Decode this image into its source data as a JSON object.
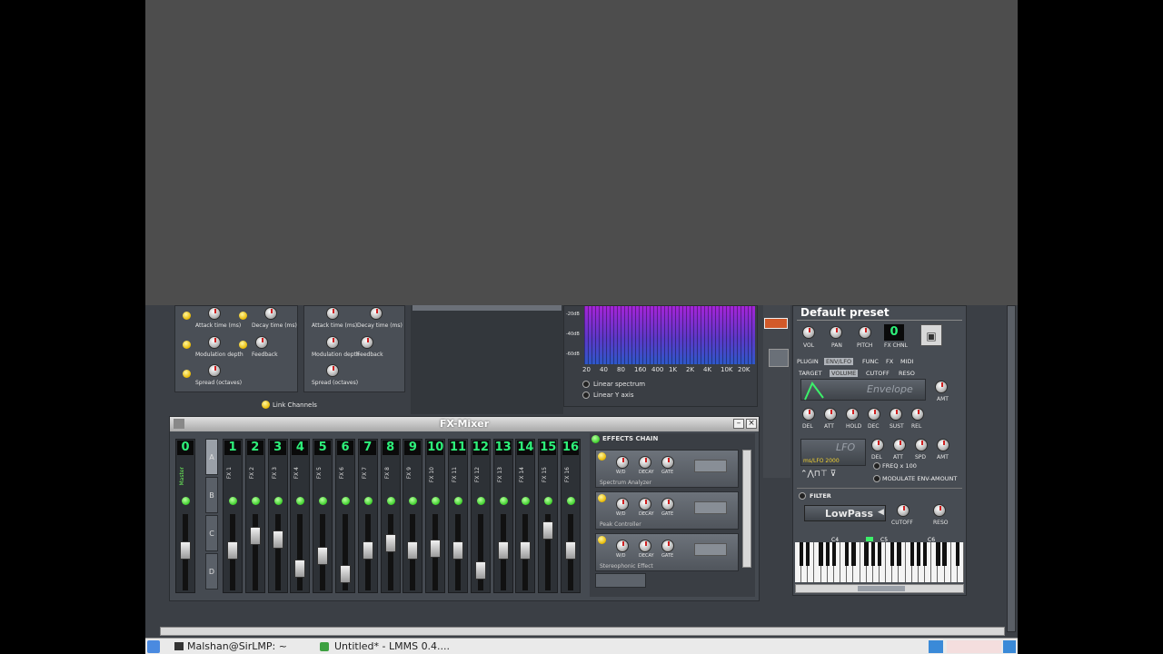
{
  "window": {
    "app_title": "LMMS"
  },
  "effects_left": {
    "knob_labels": [
      "Attack time (ms)",
      "Decay time (ms)",
      "Modulation depth",
      "Feedback",
      "Spread (octaves)"
    ],
    "link_channels": "Link Channels"
  },
  "spectrum": {
    "db_labels": [
      "-20dB",
      "-40dB",
      "-60dB"
    ],
    "freq_labels": [
      "20",
      "40",
      "80",
      "160",
      "400",
      "1K",
      "2K",
      "4K",
      "10K",
      "20K"
    ],
    "linear_spectrum": "Linear spectrum",
    "linear_y_axis": "Linear Y axis"
  },
  "fx_mixer": {
    "title": "FX-Mixer",
    "master_label": "Master",
    "channels": [
      "0",
      "1",
      "2",
      "3",
      "4",
      "5",
      "6",
      "7",
      "8",
      "9",
      "10",
      "11",
      "12",
      "13",
      "14",
      "15",
      "16"
    ],
    "channel_labels": [
      "FX 1",
      "FX 2",
      "FX 3",
      "FX 4",
      "FX 5",
      "FX 6",
      "FX 7",
      "FX 8",
      "FX 9",
      "FX 10",
      "FX 11",
      "FX 12",
      "FX 13",
      "FX 14",
      "FX 15",
      "FX 16"
    ],
    "banks": [
      "A",
      "B",
      "C",
      "D"
    ],
    "effects_chain_label": "EFFECTS CHAIN",
    "slots": [
      "Spectrum Analyzer",
      "Peak Controller",
      "Stereophonic Effect"
    ],
    "slot_knob_labels": [
      "W/D",
      "DECAY",
      "GATE"
    ]
  },
  "instrument": {
    "preset": "Default preset",
    "knobs": [
      "VOL",
      "PAN",
      "PITCH"
    ],
    "fx_channel_value": "0",
    "fx_channel_label": "FX CHNL",
    "tabs": [
      "PLUGIN",
      "ENV/LFO",
      "FUNC",
      "FX",
      "MIDI"
    ],
    "targets": [
      "TARGET",
      "VOLUME",
      "CUTOFF",
      "RESO"
    ],
    "envelope_label": "Envelope",
    "amt_label": "AMT",
    "env_knobs": [
      "DEL",
      "ATT",
      "HOLD",
      "DEC",
      "SUST",
      "REL"
    ],
    "lfo_label": "LFO",
    "lfo_display": "ms/LFO  2000",
    "lfo_knobs": [
      "DEL",
      "ATT",
      "SPD",
      "AMT"
    ],
    "freq_x100": "FREQ x 100",
    "modulate_env": "MODULATE ENV-AMOUNT",
    "filter_label": "FILTER",
    "filter_type": "LowPass",
    "filter_knobs": [
      "CUTOFF",
      "RESO"
    ],
    "piano_labels": [
      "C4",
      "C5",
      "C6"
    ]
  },
  "taskbar": {
    "item1": "Malshan@SirLMP: ~",
    "item2": "Untitled* - LMMS 0.4...."
  }
}
